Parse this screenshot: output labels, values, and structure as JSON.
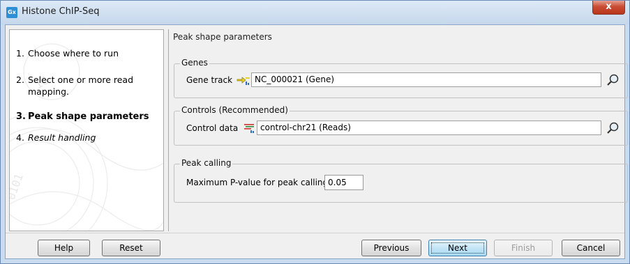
{
  "window": {
    "title": "Histone ChIP-Seq",
    "icon_text": "Gx",
    "close_label": "x"
  },
  "steps": [
    {
      "number": "1.",
      "label": "Choose where to run"
    },
    {
      "number": "2.",
      "label": "Select one or more read mapping."
    },
    {
      "number": "3.",
      "label": "Peak shape parameters"
    },
    {
      "number": "4.",
      "label": "Result handling"
    }
  ],
  "content": {
    "heading": "Peak shape parameters",
    "genes": {
      "legend": "Genes",
      "field_label": "Gene track",
      "value": "NC_000021 (Gene)",
      "icon": "gene-track-icon",
      "browse_icon": "browse-icon"
    },
    "controls": {
      "legend": "Controls (Recommended)",
      "field_label": "Control data",
      "value": "control-chr21 (Reads)",
      "icon": "reads-track-icon",
      "browse_icon": "browse-icon"
    },
    "peak_calling": {
      "legend": "Peak calling",
      "field_label": "Maximum P-value for peak calling",
      "value": "0.05"
    }
  },
  "buttons": {
    "help": "Help",
    "reset": "Reset",
    "previous": "Previous",
    "next": "Next",
    "finish": "Finish",
    "cancel": "Cancel"
  },
  "colors": {
    "window_frame": "#c9dbef",
    "close_button": "#c94c32",
    "panel_bg": "#f0f0f0",
    "default_button": "#a9d9f1"
  }
}
